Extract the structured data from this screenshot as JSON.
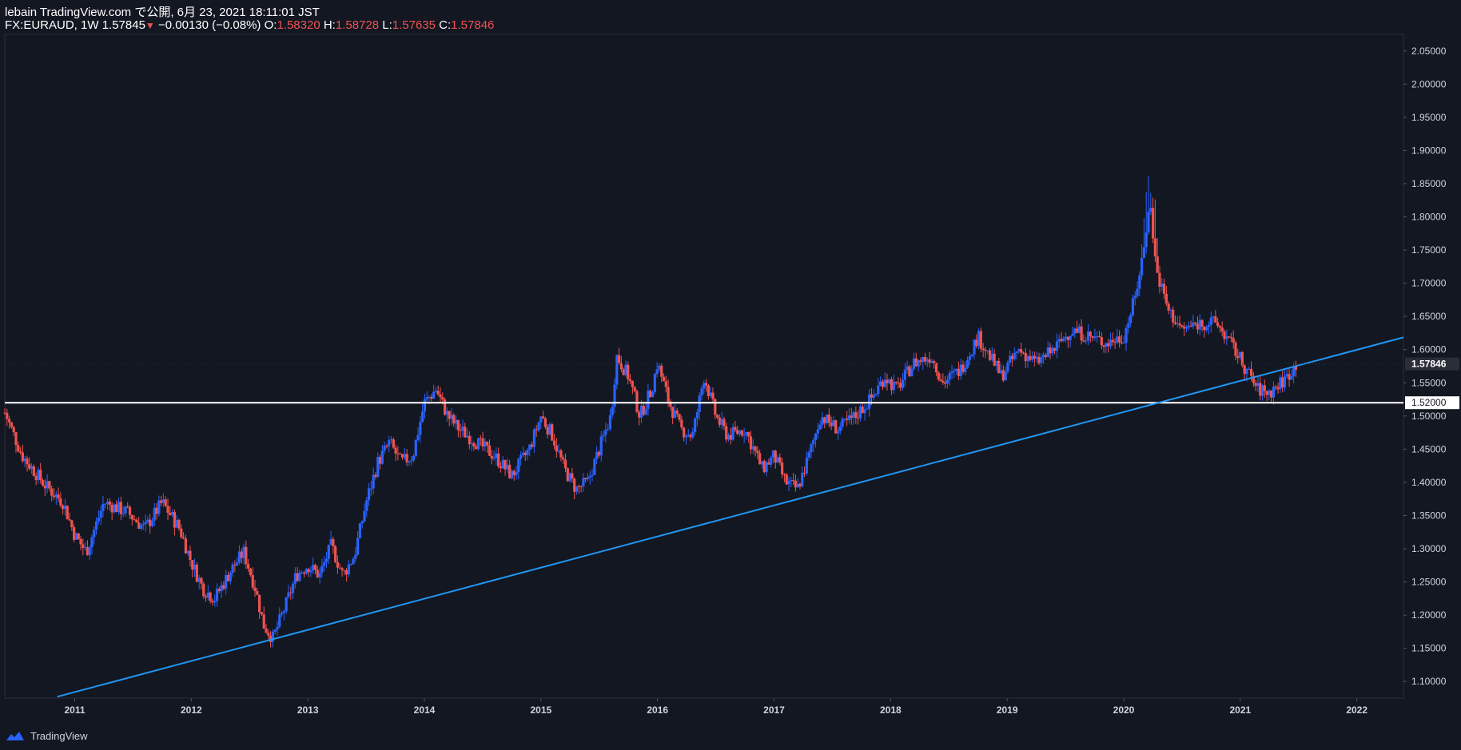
{
  "header": {
    "publish_line": "lebain TradingView.com で公開, 6月 23, 2021 18:11:01 JST",
    "symbol": "FX:EURAUD, 1W",
    "last": "1.57845",
    "change": "−0.00130 (−0.08%)",
    "o_label": "O:",
    "o_value": "1.58320",
    "h_label": "H:",
    "h_value": "1.58728",
    "l_label": "L:",
    "l_value": "1.57635",
    "c_label": "C:",
    "c_value": "1.57846"
  },
  "footer": {
    "brand": "TradingView"
  },
  "colors": {
    "background": "#131722",
    "up": "#2962ff",
    "down": "#ef5350",
    "trendline": "#2196f3",
    "hline": "#ffffff",
    "axis_text": "#d1d4dc"
  },
  "chart_data": {
    "type": "candlestick",
    "symbol": "FX:EURAUD",
    "interval": "1W",
    "xlim": [
      2010.4,
      2022.4
    ],
    "ylim": [
      1.075,
      2.075
    ],
    "x_ticks": [
      "2011",
      "2012",
      "2013",
      "2014",
      "2015",
      "2016",
      "2017",
      "2018",
      "2019",
      "2020",
      "2021",
      "2022"
    ],
    "y_ticks": [
      "1.10000",
      "1.15000",
      "1.20000",
      "1.25000",
      "1.30000",
      "1.35000",
      "1.40000",
      "1.45000",
      "1.50000",
      "1.55000",
      "1.60000",
      "1.65000",
      "1.70000",
      "1.75000",
      "1.80000",
      "1.85000",
      "1.90000",
      "1.95000",
      "2.00000",
      "2.05000"
    ],
    "price_path": [
      [
        2010.4,
        1.505
      ],
      [
        2010.55,
        1.44
      ],
      [
        2010.75,
        1.395
      ],
      [
        2010.9,
        1.37
      ],
      [
        2011.0,
        1.32
      ],
      [
        2011.1,
        1.295
      ],
      [
        2011.25,
        1.37
      ],
      [
        2011.45,
        1.355
      ],
      [
        2011.6,
        1.33
      ],
      [
        2011.75,
        1.37
      ],
      [
        2011.9,
        1.33
      ],
      [
        2012.0,
        1.28
      ],
      [
        2012.1,
        1.24
      ],
      [
        2012.2,
        1.225
      ],
      [
        2012.35,
        1.27
      ],
      [
        2012.45,
        1.295
      ],
      [
        2012.55,
        1.24
      ],
      [
        2012.62,
        1.185
      ],
      [
        2012.7,
        1.165
      ],
      [
        2012.8,
        1.21
      ],
      [
        2012.9,
        1.26
      ],
      [
        2013.0,
        1.275
      ],
      [
        2013.1,
        1.26
      ],
      [
        2013.2,
        1.305
      ],
      [
        2013.3,
        1.26
      ],
      [
        2013.4,
        1.29
      ],
      [
        2013.5,
        1.37
      ],
      [
        2013.6,
        1.43
      ],
      [
        2013.7,
        1.46
      ],
      [
        2013.8,
        1.43
      ],
      [
        2013.9,
        1.44
      ],
      [
        2014.0,
        1.52
      ],
      [
        2014.1,
        1.54
      ],
      [
        2014.2,
        1.5
      ],
      [
        2014.3,
        1.48
      ],
      [
        2014.45,
        1.46
      ],
      [
        2014.6,
        1.44
      ],
      [
        2014.75,
        1.41
      ],
      [
        2014.9,
        1.45
      ],
      [
        2015.0,
        1.5
      ],
      [
        2015.1,
        1.47
      ],
      [
        2015.2,
        1.42
      ],
      [
        2015.3,
        1.39
      ],
      [
        2015.4,
        1.4
      ],
      [
        2015.5,
        1.45
      ],
      [
        2015.6,
        1.5
      ],
      [
        2015.65,
        1.59
      ],
      [
        2015.75,
        1.56
      ],
      [
        2015.85,
        1.5
      ],
      [
        2015.95,
        1.54
      ],
      [
        2016.0,
        1.58
      ],
      [
        2016.1,
        1.52
      ],
      [
        2016.2,
        1.48
      ],
      [
        2016.3,
        1.47
      ],
      [
        2016.4,
        1.56
      ],
      [
        2016.5,
        1.5
      ],
      [
        2016.6,
        1.47
      ],
      [
        2016.75,
        1.48
      ],
      [
        2016.9,
        1.42
      ],
      [
        2017.0,
        1.44
      ],
      [
        2017.1,
        1.4
      ],
      [
        2017.2,
        1.39
      ],
      [
        2017.3,
        1.44
      ],
      [
        2017.4,
        1.5
      ],
      [
        2017.55,
        1.48
      ],
      [
        2017.7,
        1.5
      ],
      [
        2017.85,
        1.53
      ],
      [
        2017.95,
        1.56
      ],
      [
        2018.05,
        1.54
      ],
      [
        2018.2,
        1.58
      ],
      [
        2018.35,
        1.59
      ],
      [
        2018.45,
        1.55
      ],
      [
        2018.6,
        1.57
      ],
      [
        2018.75,
        1.62
      ],
      [
        2018.85,
        1.59
      ],
      [
        2018.95,
        1.56
      ],
      [
        2019.1,
        1.6
      ],
      [
        2019.25,
        1.58
      ],
      [
        2019.4,
        1.6
      ],
      [
        2019.55,
        1.63
      ],
      [
        2019.7,
        1.62
      ],
      [
        2019.85,
        1.61
      ],
      [
        2020.0,
        1.62
      ],
      [
        2020.1,
        1.68
      ],
      [
        2020.18,
        1.76
      ],
      [
        2020.22,
        1.83
      ],
      [
        2020.28,
        1.72
      ],
      [
        2020.38,
        1.66
      ],
      [
        2020.5,
        1.63
      ],
      [
        2020.65,
        1.64
      ],
      [
        2020.8,
        1.64
      ],
      [
        2020.95,
        1.6
      ],
      [
        2021.05,
        1.57
      ],
      [
        2021.15,
        1.54
      ],
      [
        2021.25,
        1.535
      ],
      [
        2021.38,
        1.555
      ],
      [
        2021.48,
        1.578
      ]
    ],
    "trendline": {
      "from": [
        2010.85,
        1.077
      ],
      "to": [
        2022.4,
        1.6185
      ]
    },
    "horizontal_line": {
      "price": 1.52,
      "label": "1.52000"
    },
    "last_price_label": "1.57846"
  }
}
